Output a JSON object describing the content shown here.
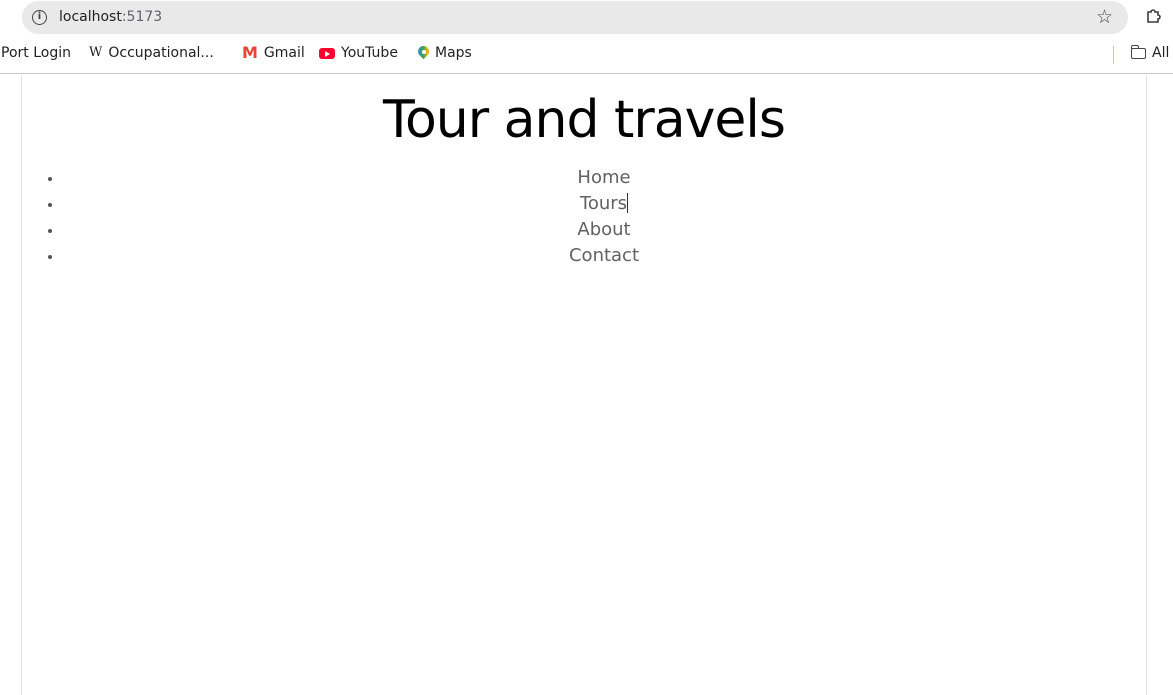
{
  "browser": {
    "url_host": "localhost",
    "url_port": ":5173",
    "bookmarks": [
      {
        "label": "Port Login",
        "icon": "none"
      },
      {
        "label": "Occupational...",
        "icon": "wikipedia-icon"
      },
      {
        "label": "Gmail",
        "icon": "gmail-icon"
      },
      {
        "label": "YouTube",
        "icon": "youtube-icon"
      },
      {
        "label": "Maps",
        "icon": "maps-icon"
      }
    ],
    "all_bookmarks_label": "All",
    "wiki_glyph": "W",
    "gmail_glyph": "M"
  },
  "page": {
    "title": "Tour and travels",
    "nav": [
      {
        "label": "Home"
      },
      {
        "label": "Tours"
      },
      {
        "label": "About"
      },
      {
        "label": "Contact"
      }
    ]
  }
}
